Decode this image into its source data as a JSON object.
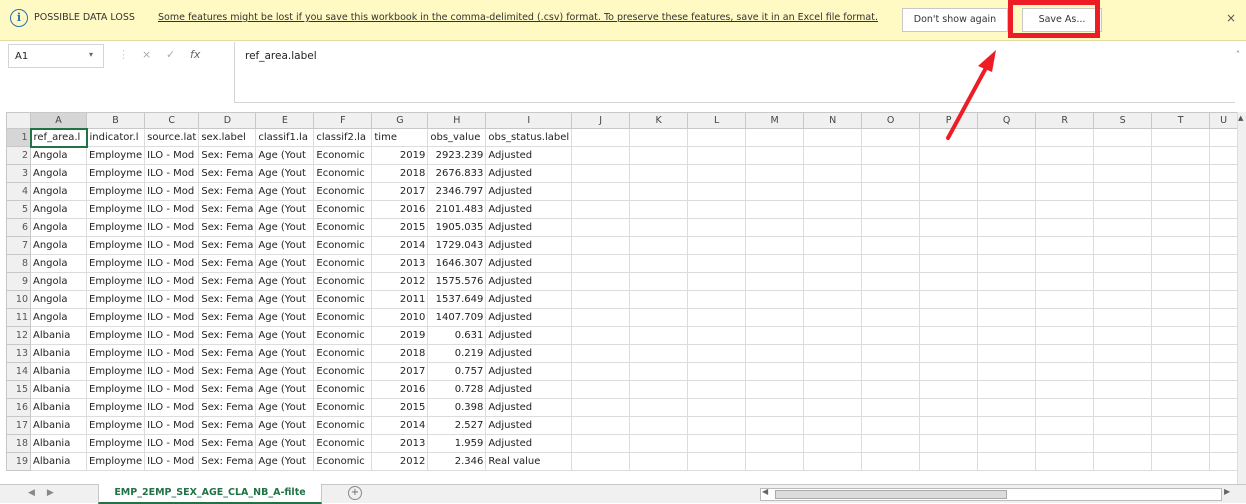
{
  "message_bar": {
    "info_icon": "i",
    "title": "POSSIBLE DATA LOSS",
    "message": "Some features might be lost if you save this workbook in the comma-delimited (.csv) format. To preserve these features, save it in an Excel file format.",
    "dont_show_label": "Don't show again",
    "save_as_label": "Save As...",
    "close_label": "×",
    "highlight_color": "#ee1c24"
  },
  "formula_bar": {
    "name_box": "A1",
    "name_box_arrow": "▾",
    "cancel_icon": "×",
    "enter_icon": "✓",
    "fx_icon": "fx",
    "content": "ref_area.label",
    "collapse_icon": "˄"
  },
  "grid": {
    "columns": [
      "A",
      "B",
      "C",
      "D",
      "E",
      "F",
      "G",
      "H",
      "I",
      "J",
      "K",
      "L",
      "M",
      "N",
      "O",
      "P",
      "Q",
      "R",
      "S",
      "T",
      "U"
    ],
    "rows": [
      [
        "ref_area.l",
        "indicator.l",
        "source.lat",
        "sex.label",
        "classif1.la",
        "classif2.la",
        "time",
        "obs_value",
        "obs_status.label",
        "",
        "",
        "",
        "",
        "",
        "",
        "",
        "",
        "",
        "",
        "",
        ""
      ],
      [
        "Angola",
        "Employme",
        "ILO - Mod",
        "Sex: Fema",
        "Age (Yout",
        "Economic",
        "2019",
        "2923.239",
        "Adjusted",
        "",
        "",
        "",
        "",
        "",
        "",
        "",
        "",
        "",
        "",
        "",
        ""
      ],
      [
        "Angola",
        "Employme",
        "ILO - Mod",
        "Sex: Fema",
        "Age (Yout",
        "Economic",
        "2018",
        "2676.833",
        "Adjusted",
        "",
        "",
        "",
        "",
        "",
        "",
        "",
        "",
        "",
        "",
        "",
        ""
      ],
      [
        "Angola",
        "Employme",
        "ILO - Mod",
        "Sex: Fema",
        "Age (Yout",
        "Economic",
        "2017",
        "2346.797",
        "Adjusted",
        "",
        "",
        "",
        "",
        "",
        "",
        "",
        "",
        "",
        "",
        "",
        ""
      ],
      [
        "Angola",
        "Employme",
        "ILO - Mod",
        "Sex: Fema",
        "Age (Yout",
        "Economic",
        "2016",
        "2101.483",
        "Adjusted",
        "",
        "",
        "",
        "",
        "",
        "",
        "",
        "",
        "",
        "",
        "",
        ""
      ],
      [
        "Angola",
        "Employme",
        "ILO - Mod",
        "Sex: Fema",
        "Age (Yout",
        "Economic",
        "2015",
        "1905.035",
        "Adjusted",
        "",
        "",
        "",
        "",
        "",
        "",
        "",
        "",
        "",
        "",
        "",
        ""
      ],
      [
        "Angola",
        "Employme",
        "ILO - Mod",
        "Sex: Fema",
        "Age (Yout",
        "Economic",
        "2014",
        "1729.043",
        "Adjusted",
        "",
        "",
        "",
        "",
        "",
        "",
        "",
        "",
        "",
        "",
        "",
        ""
      ],
      [
        "Angola",
        "Employme",
        "ILO - Mod",
        "Sex: Fema",
        "Age (Yout",
        "Economic",
        "2013",
        "1646.307",
        "Adjusted",
        "",
        "",
        "",
        "",
        "",
        "",
        "",
        "",
        "",
        "",
        "",
        ""
      ],
      [
        "Angola",
        "Employme",
        "ILO - Mod",
        "Sex: Fema",
        "Age (Yout",
        "Economic",
        "2012",
        "1575.576",
        "Adjusted",
        "",
        "",
        "",
        "",
        "",
        "",
        "",
        "",
        "",
        "",
        "",
        ""
      ],
      [
        "Angola",
        "Employme",
        "ILO - Mod",
        "Sex: Fema",
        "Age (Yout",
        "Economic",
        "2011",
        "1537.649",
        "Adjusted",
        "",
        "",
        "",
        "",
        "",
        "",
        "",
        "",
        "",
        "",
        "",
        ""
      ],
      [
        "Angola",
        "Employme",
        "ILO - Mod",
        "Sex: Fema",
        "Age (Yout",
        "Economic",
        "2010",
        "1407.709",
        "Adjusted",
        "",
        "",
        "",
        "",
        "",
        "",
        "",
        "",
        "",
        "",
        "",
        ""
      ],
      [
        "Albania",
        "Employme",
        "ILO - Mod",
        "Sex: Fema",
        "Age (Yout",
        "Economic",
        "2019",
        "0.631",
        "Adjusted",
        "",
        "",
        "",
        "",
        "",
        "",
        "",
        "",
        "",
        "",
        "",
        ""
      ],
      [
        "Albania",
        "Employme",
        "ILO - Mod",
        "Sex: Fema",
        "Age (Yout",
        "Economic",
        "2018",
        "0.219",
        "Adjusted",
        "",
        "",
        "",
        "",
        "",
        "",
        "",
        "",
        "",
        "",
        "",
        ""
      ],
      [
        "Albania",
        "Employme",
        "ILO - Mod",
        "Sex: Fema",
        "Age (Yout",
        "Economic",
        "2017",
        "0.757",
        "Adjusted",
        "",
        "",
        "",
        "",
        "",
        "",
        "",
        "",
        "",
        "",
        "",
        ""
      ],
      [
        "Albania",
        "Employme",
        "ILO - Mod",
        "Sex: Fema",
        "Age (Yout",
        "Economic",
        "2016",
        "0.728",
        "Adjusted",
        "",
        "",
        "",
        "",
        "",
        "",
        "",
        "",
        "",
        "",
        "",
        ""
      ],
      [
        "Albania",
        "Employme",
        "ILO - Mod",
        "Sex: Fema",
        "Age (Yout",
        "Economic",
        "2015",
        "0.398",
        "Adjusted",
        "",
        "",
        "",
        "",
        "",
        "",
        "",
        "",
        "",
        "",
        "",
        ""
      ],
      [
        "Albania",
        "Employme",
        "ILO - Mod",
        "Sex: Fema",
        "Age (Yout",
        "Economic",
        "2014",
        "2.527",
        "Adjusted",
        "",
        "",
        "",
        "",
        "",
        "",
        "",
        "",
        "",
        "",
        "",
        ""
      ],
      [
        "Albania",
        "Employme",
        "ILO - Mod",
        "Sex: Fema",
        "Age (Yout",
        "Economic",
        "2013",
        "1.959",
        "Adjusted",
        "",
        "",
        "",
        "",
        "",
        "",
        "",
        "",
        "",
        "",
        "",
        ""
      ],
      [
        "Albania",
        "Employme",
        "ILO - Mod",
        "Sex: Fema",
        "Age (Yout",
        "Economic",
        "2012",
        "2.346",
        "Real value",
        "",
        "",
        "",
        "",
        "",
        "",
        "",
        "",
        "",
        "",
        "",
        ""
      ]
    ]
  },
  "sheet_tabs": {
    "nav_prev": "◀",
    "nav_next": "▶",
    "active_tab": "EMP_2EMP_SEX_AGE_CLA_NB_A-filte",
    "add_sheet": "+"
  },
  "scroll": {
    "left_arrow": "◀",
    "right_arrow": "▶",
    "up_arrow": "▲"
  },
  "annotation": {
    "arrow_color": "#ee1c24"
  }
}
